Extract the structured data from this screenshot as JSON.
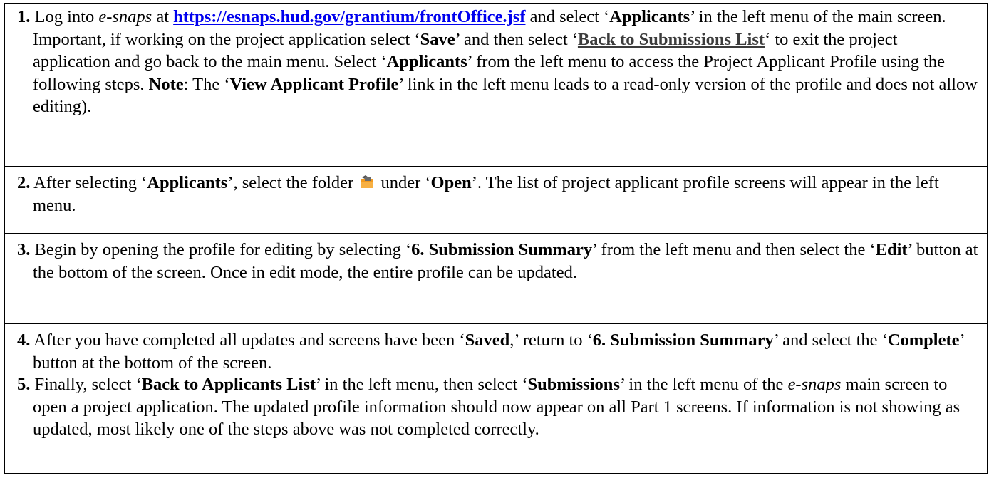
{
  "steps": [
    {
      "number": "1.",
      "t1": "Log into ",
      "app_name": "e-snaps",
      "t2": " at ",
      "url": "https://esnaps.hud.gov/grantium/frontOffice.jsf",
      "t3": " and select ‘",
      "b1": "Applicants",
      "t4": "’ in the left menu of the main screen. Important, if working on the project application select ‘",
      "b2": "Save",
      "t5": "’ and then select ‘",
      "button_text": "Back to Submissions List",
      "t6": "‘ to exit the project application and go back to the main menu. Select ‘",
      "b3": "Applicants",
      "t7": "’ from the left menu to access the Project Applicant Profile using the following steps.  ",
      "note_label": "Note",
      "t8": ": The ‘",
      "b4": "View Applicant Profile",
      "t9": "’ link in the left menu leads to a read-only version of the profile and does not allow editing)."
    },
    {
      "number": "2.",
      "t1": " After selecting ‘",
      "b1": "Applicants",
      "t2": "’, select the folder ",
      "icon": "folder-open-icon",
      "t3": " under ‘",
      "b2": "Open",
      "t4": "’. The list of project applicant profile screens will appear in the left menu."
    },
    {
      "number": "3.",
      "t1": " Begin by opening the profile for editing by selecting ‘",
      "b1": "6. Submission Summary",
      "t2": "’ from the left menu and then select the ‘",
      "b2": "Edit",
      "t3": "’ button at the bottom of the screen. Once in edit mode, the entire profile can be updated."
    },
    {
      "number": "4.",
      "t1": " After you have completed all updates and screens have been ‘",
      "b1": "Saved",
      "t2": ",’ return to ‘",
      "b2": "6. Submission Summary",
      "t3": "’ and select the ‘",
      "b3": "Complete",
      "t4": "’ button at the bottom of the screen."
    },
    {
      "number": "5.",
      "t1": " Finally, select ‘",
      "b1": "Back to Applicants List",
      "t2": "’ in the left menu, then select ‘",
      "b2": "Submissions",
      "t3": "’ in the left menu of the ",
      "app_name": "e-snaps",
      "t4": " main screen to open a project application. The updated profile information should now appear on all Part 1 screens. If information is not showing as updated, most likely one of the steps above was not completed correctly."
    }
  ],
  "colors": {
    "link": "#0000ee",
    "button_text": "#3c3c3c",
    "icon_orange": "#f39a1e",
    "border": "#000000"
  }
}
